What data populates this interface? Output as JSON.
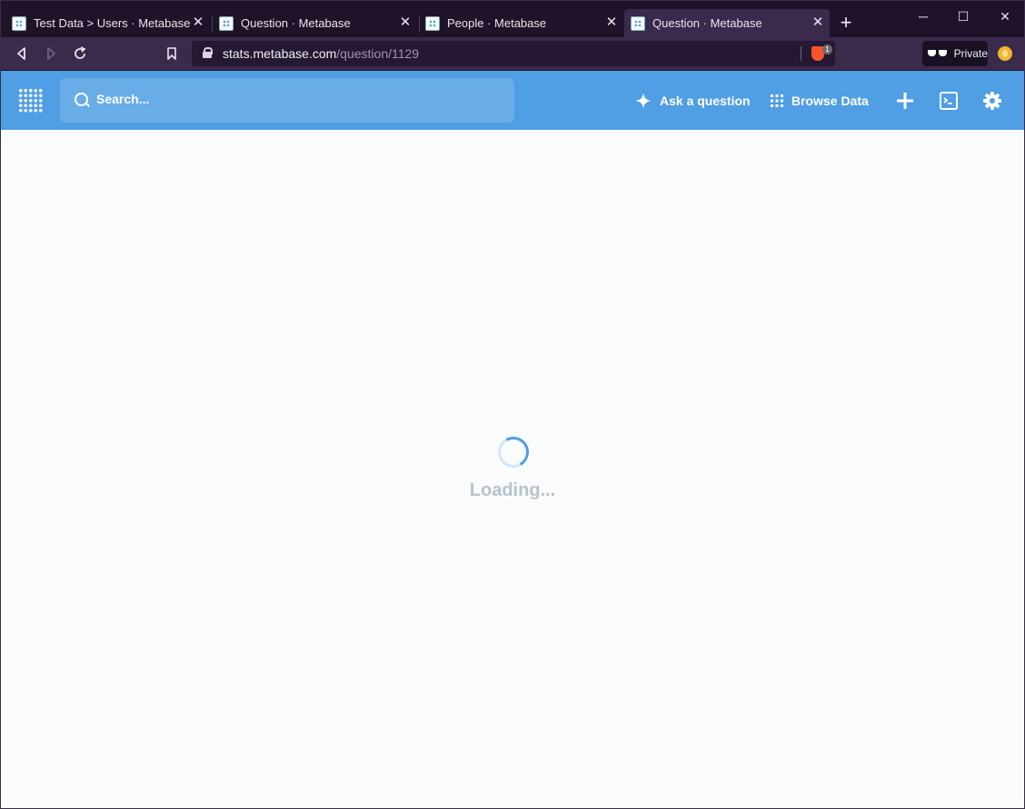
{
  "browser": {
    "tabs": [
      {
        "title": "Test Data > Users · Metabase",
        "active": false
      },
      {
        "title": "Question · Metabase",
        "active": false
      },
      {
        "title": "People · Metabase",
        "active": false
      },
      {
        "title": "Question · Metabase",
        "active": true
      }
    ],
    "url_host": "stats.metabase.com",
    "url_path": "/question/1129",
    "shields_count": "1",
    "private_label": "Private",
    "window_controls": {
      "minimize": "─",
      "maximize": "☐",
      "close": "✕"
    }
  },
  "app": {
    "search_placeholder": "Search...",
    "ask_question_label": "Ask a question",
    "browse_data_label": "Browse Data",
    "accent_color": "#509ee3"
  },
  "main": {
    "loading_text": "Loading..."
  },
  "icons": [
    "metabase-logo",
    "search-icon",
    "sparkle-icon",
    "grid-icon",
    "plus-icon",
    "terminal-icon",
    "gear-icon",
    "lock-icon",
    "bookmark-icon",
    "reload-icon",
    "back-icon",
    "forward-icon"
  ]
}
